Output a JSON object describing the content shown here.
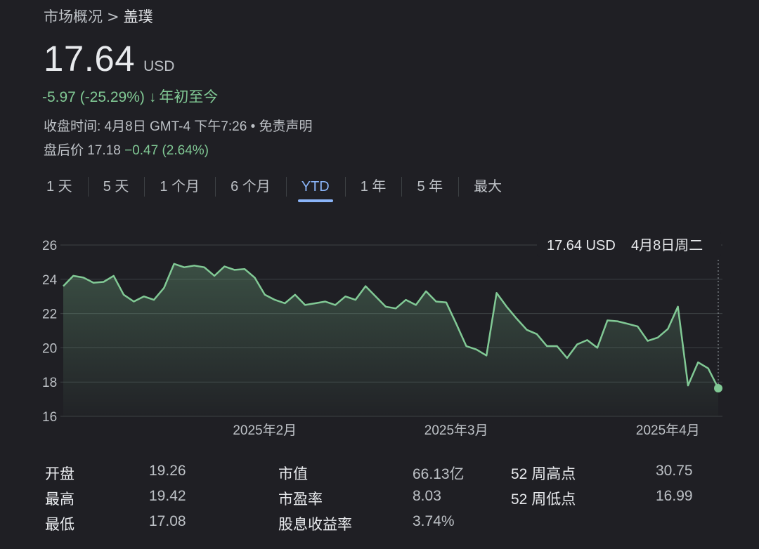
{
  "breadcrumb": {
    "parent": "市场概况",
    "separator": ">",
    "current": "盖璞"
  },
  "quote": {
    "price": "17.64",
    "currency": "USD",
    "change": "-5.97 (-25.29%)",
    "change_arrow": "↓",
    "change_period": "年初至今",
    "close_time_label": "收盘时间: 4月8日 GMT-4 下午7:26",
    "separator": "•",
    "disclaimer": "免责声明",
    "after_hours_label": "盘后价 17.18",
    "after_hours_change": "−0.47 (2.64%)"
  },
  "tabs": [
    {
      "label": "1 天",
      "active": false
    },
    {
      "label": "5 天",
      "active": false
    },
    {
      "label": "1 个月",
      "active": false
    },
    {
      "label": "6 个月",
      "active": false
    },
    {
      "label": "YTD",
      "active": true
    },
    {
      "label": "1 年",
      "active": false
    },
    {
      "label": "5 年",
      "active": false
    },
    {
      "label": "最大",
      "active": false
    }
  ],
  "tooltip": {
    "price": "17.64 USD",
    "date": "4月8日周二"
  },
  "colors": {
    "background": "#1f1f24",
    "line": "#81c995",
    "positive": "#81c995",
    "active_tab": "#8ab4f8"
  },
  "chart_data": {
    "type": "area",
    "ylim": [
      16,
      26
    ],
    "yticks": [
      16,
      18,
      20,
      22,
      24,
      26
    ],
    "x_label_ticks": [
      {
        "label": "2025年2月",
        "index": 20
      },
      {
        "label": "2025年3月",
        "index": 39
      },
      {
        "label": "2025年4月",
        "index": 60
      }
    ],
    "grid": true,
    "values": [
      23.6,
      24.2,
      24.1,
      23.8,
      23.85,
      24.2,
      23.1,
      22.7,
      23.0,
      22.8,
      23.5,
      24.9,
      24.7,
      24.8,
      24.7,
      24.2,
      24.75,
      24.55,
      24.6,
      24.1,
      23.1,
      22.8,
      22.6,
      23.1,
      22.5,
      22.6,
      22.7,
      22.5,
      23.0,
      22.8,
      23.6,
      23.0,
      22.4,
      22.3,
      22.8,
      22.5,
      23.3,
      22.7,
      22.65,
      21.4,
      20.1,
      19.9,
      19.55,
      23.2,
      22.4,
      21.7,
      21.05,
      20.8,
      20.1,
      20.1,
      19.4,
      20.2,
      20.45,
      20.0,
      21.6,
      21.55,
      21.4,
      21.25,
      20.4,
      20.6,
      21.1,
      22.4,
      17.8,
      19.15,
      18.8,
      17.64
    ],
    "last_value": 17.64
  },
  "stats": {
    "open_label": "开盘",
    "open_value": "19.26",
    "high_label": "最高",
    "high_value": "19.42",
    "low_label": "最低",
    "low_value": "17.08",
    "mktcap_label": "市值",
    "mktcap_value": "66.13亿",
    "pe_label": "市盈率",
    "pe_value": "8.03",
    "yield_label": "股息收益率",
    "yield_value": "3.74%",
    "high52_label": "52 周高点",
    "high52_value": "30.75",
    "low52_label": "52 周低点",
    "low52_value": "16.99"
  }
}
